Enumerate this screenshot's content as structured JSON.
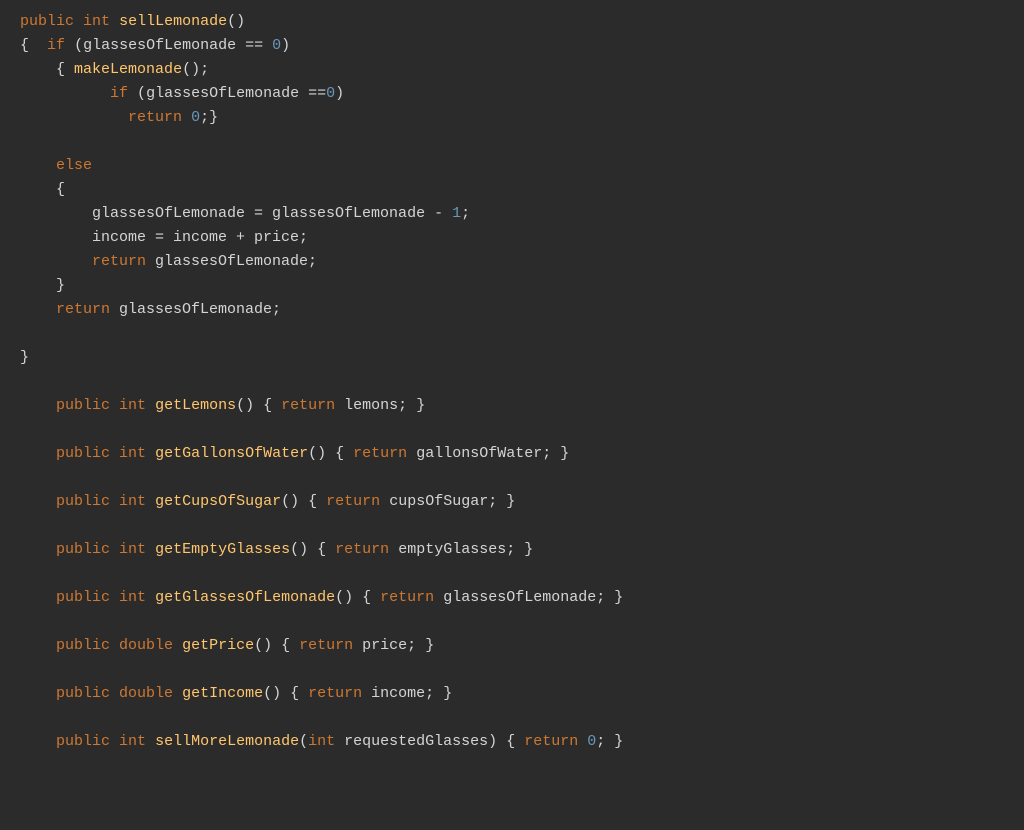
{
  "editor": {
    "background": "#2b2b2b",
    "lines": [
      {
        "id": 1,
        "content": "public int sellLemonade()"
      },
      {
        "id": 2,
        "content": "{  if (glassesOfLemonade == 0)"
      },
      {
        "id": 3,
        "content": "    { makeLemonade();"
      },
      {
        "id": 4,
        "content": "          if (glassesOfLemonade ==0)"
      },
      {
        "id": 5,
        "content": "            return 0;}"
      },
      {
        "id": 6,
        "content": ""
      },
      {
        "id": 7,
        "content": "    else"
      },
      {
        "id": 8,
        "content": "    {"
      },
      {
        "id": 9,
        "content": "        glassesOfLemonade = glassesOfLemonade - 1;"
      },
      {
        "id": 10,
        "content": "        income = income + price;"
      },
      {
        "id": 11,
        "content": "        return glassesOfLemonade;"
      },
      {
        "id": 12,
        "content": "    }"
      },
      {
        "id": 13,
        "content": "    return glassesOfLemonade;"
      },
      {
        "id": 14,
        "content": ""
      },
      {
        "id": 15,
        "content": "}"
      },
      {
        "id": 16,
        "content": ""
      },
      {
        "id": 17,
        "content": "    public int getLemons() { return lemons; }"
      },
      {
        "id": 18,
        "content": ""
      },
      {
        "id": 19,
        "content": "    public int getGallonsOfWater() { return gallonsOfWater; }"
      },
      {
        "id": 20,
        "content": ""
      },
      {
        "id": 21,
        "content": "    public int getCupsOfSugar() { return cupsOfSugar; }"
      },
      {
        "id": 22,
        "content": ""
      },
      {
        "id": 23,
        "content": "    public int getEmptyGlasses() { return emptyGlasses; }"
      },
      {
        "id": 24,
        "content": ""
      },
      {
        "id": 25,
        "content": "    public int getGlassesOfLemonade() { return glassesOfLemonade; }"
      },
      {
        "id": 26,
        "content": ""
      },
      {
        "id": 27,
        "content": "    public double getPrice() { return price; }"
      },
      {
        "id": 28,
        "content": ""
      },
      {
        "id": 29,
        "content": "    public double getIncome() { return income; }"
      },
      {
        "id": 30,
        "content": ""
      },
      {
        "id": 31,
        "content": "    public int sellMoreLemonade(int requestedGlasses) { return 0; }"
      }
    ]
  }
}
